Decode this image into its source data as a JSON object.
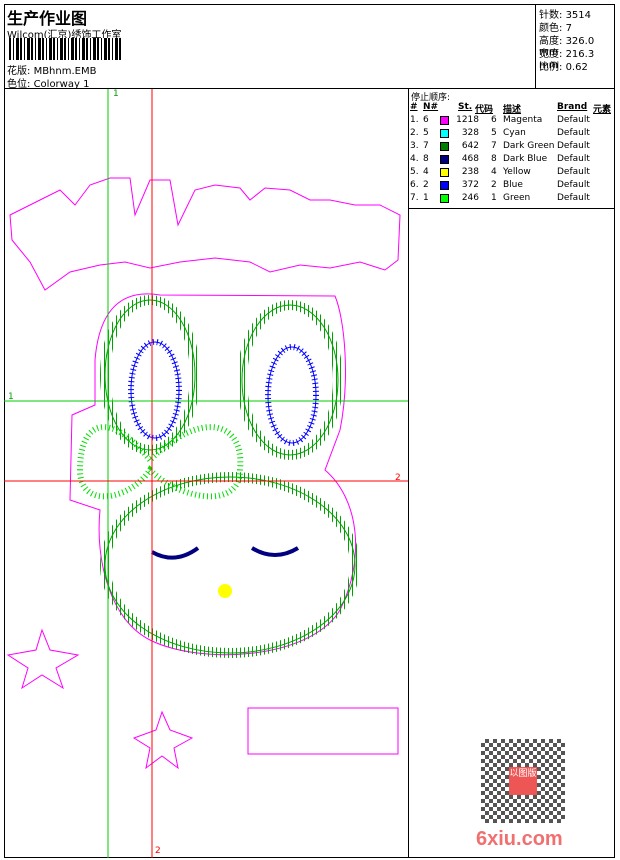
{
  "header": {
    "title": "生产作业图",
    "company": "Wilcom(汇京)绣饰工作室",
    "pattern_label": "花版:",
    "pattern_value": "MBhnm.EMB",
    "colorway_label": "色位:",
    "colorway_value": "Colorway 1"
  },
  "info": [
    {
      "label": "针数:",
      "value": "3514"
    },
    {
      "label": "颜色:",
      "value": "7"
    },
    {
      "label": "高度:",
      "value": "326.0 mm"
    },
    {
      "label": "宽度:",
      "value": "216.3 mm"
    },
    {
      "label": "比例:",
      "value": "0.62"
    }
  ],
  "table": {
    "caption": "停止顺序:",
    "headers": [
      "#",
      "N#",
      "St.",
      "代码",
      "描述",
      "Brand",
      "元素"
    ],
    "rows": [
      {
        "idx": "1.",
        "n": "6",
        "color": "#ff00ff",
        "st": "1218",
        "code": "6",
        "desc": "Magenta",
        "brand": "Default"
      },
      {
        "idx": "2.",
        "n": "5",
        "color": "#00ffff",
        "st": "328",
        "code": "5",
        "desc": "Cyan",
        "brand": "Default"
      },
      {
        "idx": "3.",
        "n": "7",
        "color": "#008000",
        "st": "642",
        "code": "7",
        "desc": "Dark Green",
        "brand": "Default"
      },
      {
        "idx": "4.",
        "n": "8",
        "color": "#000080",
        "st": "468",
        "code": "8",
        "desc": "Dark Blue",
        "brand": "Default"
      },
      {
        "idx": "5.",
        "n": "4",
        "color": "#ffff00",
        "st": "238",
        "code": "4",
        "desc": "Yellow",
        "brand": "Default"
      },
      {
        "idx": "6.",
        "n": "2",
        "color": "#0000ff",
        "st": "372",
        "code": "2",
        "desc": "Blue",
        "brand": "Default"
      },
      {
        "idx": "7.",
        "n": "1",
        "color": "#00ff00",
        "st": "246",
        "code": "1",
        "desc": "Green",
        "brand": "Default"
      }
    ]
  },
  "guides": {
    "v1": "1",
    "h1": "1",
    "h2": "2",
    "v2": "2"
  },
  "watermark": {
    "text": "6xiu.com",
    "seal": "以图版"
  }
}
